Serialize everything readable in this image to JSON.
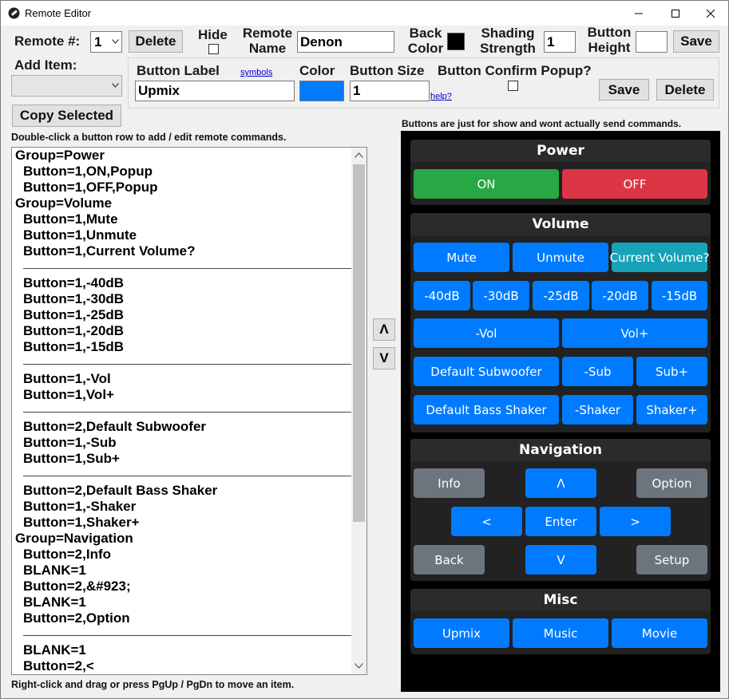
{
  "window": {
    "title": "Remote Editor"
  },
  "header": {
    "remote_num_label": "Remote #:",
    "remote_num_value": "1",
    "delete_label": "Delete",
    "hide_label": "Hide",
    "remote_name_label_1": "Remote",
    "remote_name_label_2": "Name",
    "remote_name_value": "Denon",
    "back_color_label_1": "Back",
    "back_color_label_2": "Color",
    "back_color_value": "#000000",
    "shading_label_1": "Shading",
    "shading_label_2": "Strength",
    "shading_value": "1",
    "button_height_label_1": "Button",
    "button_height_label_2": "Height",
    "button_height_value": "",
    "save_label": "Save"
  },
  "add_item": {
    "label": "Add Item:",
    "value": ""
  },
  "item_editor": {
    "button_label_label": "Button Label",
    "symbols_link": "symbols",
    "button_label_value": "Upmix",
    "color_label": "Color",
    "color_value": "#007bff",
    "button_size_label": "Button Size",
    "button_size_value": "1",
    "help_link": "help?",
    "confirm_label": "Button Confirm Popup?",
    "save_label": "Save",
    "delete_label": "Delete"
  },
  "copy_selected_label": "Copy Selected",
  "list_hint": "Double-click a button row to add / edit remote commands.",
  "footer_hint": "Right-click and drag or press PgUp / PgDn to move an item.",
  "preview_note": "Buttons are just for show and wont actually send commands.",
  "move_up_label": "Λ",
  "move_down_label": "V",
  "list_rows": [
    {
      "text": "Group=Power",
      "kind": "group"
    },
    {
      "text": "Button=1,ON,Popup",
      "kind": "item"
    },
    {
      "text": "Button=1,OFF,Popup",
      "kind": "item"
    },
    {
      "text": "Group=Volume",
      "kind": "group"
    },
    {
      "text": "Button=1,Mute",
      "kind": "item"
    },
    {
      "text": "Button=1,Unmute",
      "kind": "item"
    },
    {
      "text": "Button=1,Current Volume?",
      "kind": "item"
    },
    {
      "text": "",
      "kind": "sep"
    },
    {
      "text": "Button=1,-40dB",
      "kind": "item"
    },
    {
      "text": "Button=1,-30dB",
      "kind": "item"
    },
    {
      "text": "Button=1,-25dB",
      "kind": "item"
    },
    {
      "text": "Button=1,-20dB",
      "kind": "item"
    },
    {
      "text": "Button=1,-15dB",
      "kind": "item"
    },
    {
      "text": "",
      "kind": "sep"
    },
    {
      "text": "Button=1,-Vol",
      "kind": "item"
    },
    {
      "text": "Button=1,Vol+",
      "kind": "item"
    },
    {
      "text": "",
      "kind": "sep"
    },
    {
      "text": "Button=2,Default Subwoofer",
      "kind": "item"
    },
    {
      "text": "Button=1,-Sub",
      "kind": "item"
    },
    {
      "text": "Button=1,Sub+",
      "kind": "item"
    },
    {
      "text": "",
      "kind": "sep"
    },
    {
      "text": "Button=2,Default Bass Shaker",
      "kind": "item"
    },
    {
      "text": "Button=1,-Shaker",
      "kind": "item"
    },
    {
      "text": "Button=1,Shaker+",
      "kind": "item"
    },
    {
      "text": "Group=Navigation",
      "kind": "group"
    },
    {
      "text": "Button=2,Info",
      "kind": "item"
    },
    {
      "text": "BLANK=1",
      "kind": "item"
    },
    {
      "text": "Button=2,&#923;",
      "kind": "item"
    },
    {
      "text": "BLANK=1",
      "kind": "item"
    },
    {
      "text": "Button=2,Option",
      "kind": "item"
    },
    {
      "text": "",
      "kind": "sep"
    },
    {
      "text": "BLANK=1",
      "kind": "item"
    },
    {
      "text": "Button=2,<",
      "kind": "item"
    }
  ],
  "preview": {
    "power": {
      "title": "Power",
      "on": "ON",
      "off": "OFF"
    },
    "volume": {
      "title": "Volume",
      "mute": "Mute",
      "unmute": "Unmute",
      "current": "Current Volume?",
      "db40": "-40dB",
      "db30": "-30dB",
      "db25": "-25dB",
      "db20": "-20dB",
      "db15": "-15dB",
      "vol_down": "-Vol",
      "vol_up": "Vol+",
      "default_sub": "Default Subwoofer",
      "sub_down": "-Sub",
      "sub_up": "Sub+",
      "default_shaker": "Default Bass Shaker",
      "shaker_down": "-Shaker",
      "shaker_up": "Shaker+"
    },
    "navigation": {
      "title": "Navigation",
      "info": "Info",
      "up": "Λ",
      "option": "Option",
      "left": "<",
      "enter": "Enter",
      "right": ">",
      "back": "Back",
      "down": "V",
      "setup": "Setup"
    },
    "misc": {
      "title": "Misc",
      "upmix": "Upmix",
      "music": "Music",
      "movie": "Movie"
    }
  }
}
